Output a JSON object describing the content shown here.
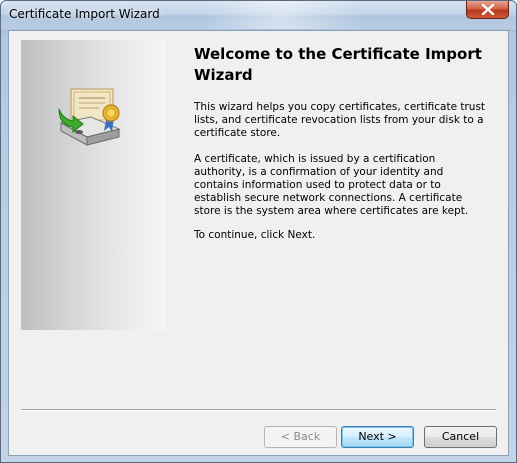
{
  "window": {
    "title": "Certificate Import Wizard"
  },
  "content": {
    "heading": "Welcome to the Certificate Import Wizard",
    "paragraphs": [
      "This wizard helps you copy certificates, certificate trust lists, and certificate revocation lists from your disk to a certificate store.",
      "A certificate, which is issued by a certification authority, is a confirmation of your identity and contains information used to protect data or to establish secure network connections. A certificate store is the system area where certificates are kept.",
      "To continue, click Next."
    ]
  },
  "buttons": {
    "back": "< Back",
    "next": "Next >",
    "cancel": "Cancel"
  },
  "icons": {
    "close": "close-icon",
    "wizard_art": "certificate-import-icon"
  },
  "colors": {
    "close_button": "#c8462a",
    "default_button_border": "#3c7fb1",
    "side_panel": "#d6d6d6"
  }
}
